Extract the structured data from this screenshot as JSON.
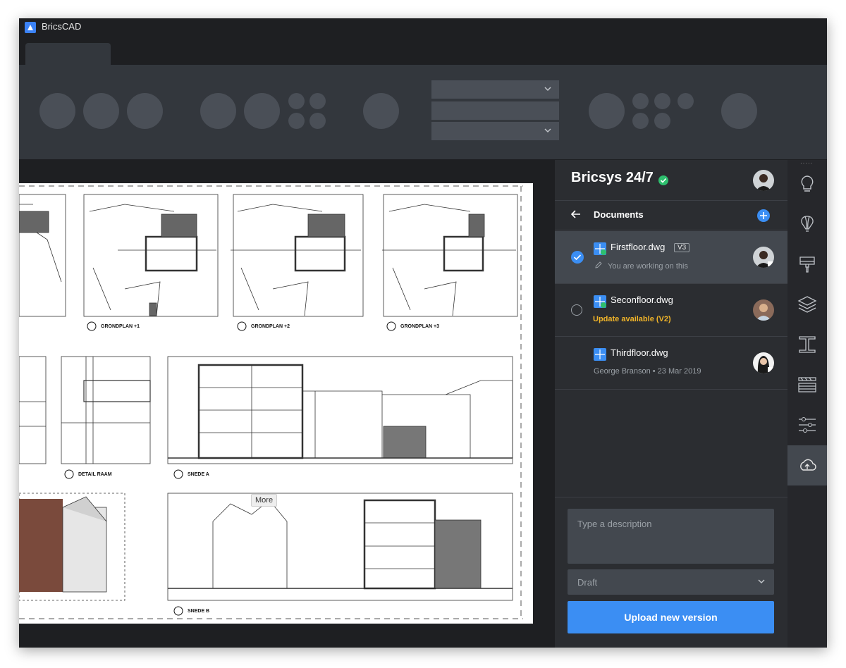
{
  "app": {
    "title": "BricsCAD"
  },
  "drawing": {
    "labels": [
      "GRONDPLAN +1",
      "GRONDPLAN +2",
      "GRONDPLAN +3",
      "DETAIL RAAM",
      "SNEDE A",
      "SNEDE B"
    ],
    "tooltip": "More"
  },
  "panel": {
    "title": "Bricsys 24/7",
    "nav_label": "Documents",
    "files": [
      {
        "name": "Firstfloor.dwg",
        "version": "V3",
        "status": "You are working on this",
        "selected": true
      },
      {
        "name": "Seconfloor.dwg",
        "status": "Update available (V2)",
        "selected": false
      },
      {
        "name": "Thirdfloor.dwg",
        "status": "George Branson • 23 Mar 2019",
        "selected": false
      }
    ],
    "description_placeholder": "Type a description",
    "status_select": "Draft",
    "upload_label": "Upload new version"
  },
  "sidebar_icons": [
    "lightbulb-icon",
    "balloon-icon",
    "paint-brush-icon",
    "layers-icon",
    "beam-icon",
    "hatch-icon",
    "sliders-icon",
    "cloud-upload-icon"
  ],
  "colors": {
    "accent": "#3b8ef3",
    "success": "#2ebf6e",
    "warning": "#f0b429",
    "panel": "#2b2d31"
  }
}
